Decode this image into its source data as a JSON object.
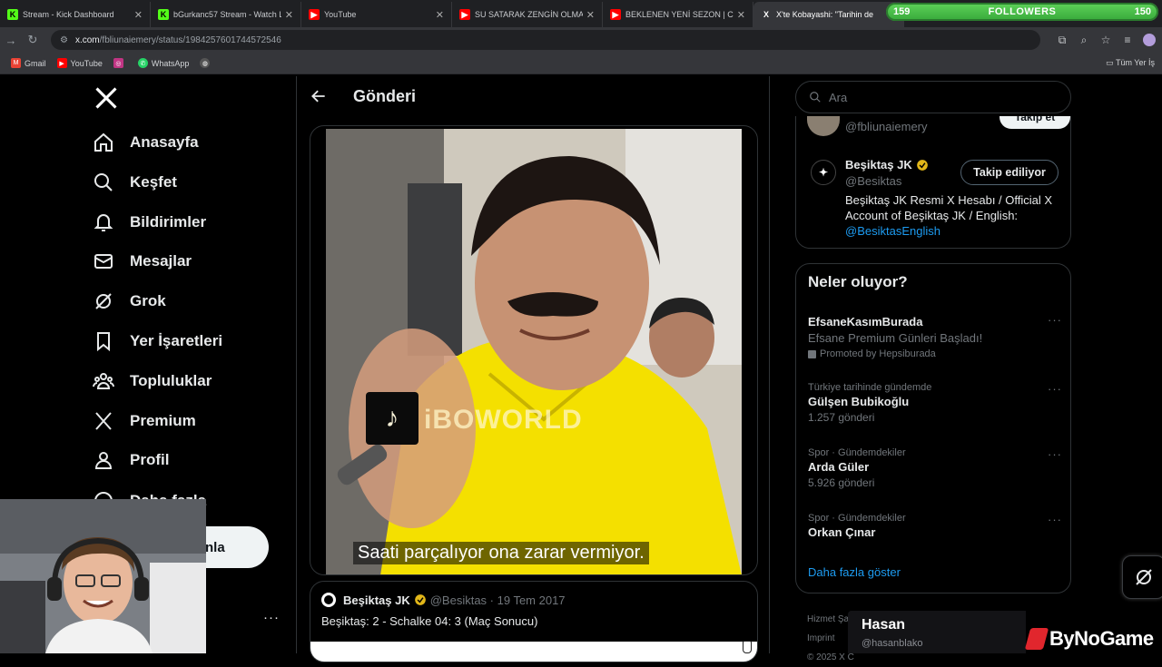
{
  "tabs": [
    {
      "title": "Stream - Kick Dashboard",
      "favicon": "K"
    },
    {
      "title": "bGurkanc57 Stream - Watch Li",
      "favicon": "K"
    },
    {
      "title": "YouTube",
      "favicon": "▶"
    },
    {
      "title": "SU SATARAK ZENGİN OLMAK! (",
      "favicon": "▶"
    },
    {
      "title": "BEKLENEN YENİ SEZON | CİHA",
      "favicon": "▶"
    },
    {
      "title": "X'te Kobayashi: \"Tarihin de",
      "favicon": "X"
    }
  ],
  "followers_overlay": {
    "left_count": "159",
    "label": "FOLLOWERS",
    "right_count": "150"
  },
  "address": {
    "host": "x.com",
    "path": "/fbliunaiemery/status/1984257601744572546"
  },
  "bookmarks": [
    {
      "label": "Gmail",
      "color": "#ea4335"
    },
    {
      "label": "YouTube",
      "color": "#ff0000"
    },
    {
      "label": "",
      "color": "#c13584"
    },
    {
      "label": "WhatsApp",
      "color": "#25d366"
    },
    {
      "label": "",
      "color": "#888888"
    }
  ],
  "bookmarks_right": "Tüm Yer İş",
  "nav": {
    "items": [
      {
        "label": "Anasayfa",
        "icon": "home-icon"
      },
      {
        "label": "Keşfet",
        "icon": "search-icon"
      },
      {
        "label": "Bildirimler",
        "icon": "bell-icon"
      },
      {
        "label": "Mesajlar",
        "icon": "mail-icon"
      },
      {
        "label": "Grok",
        "icon": "grok-icon"
      },
      {
        "label": "Yer İşaretleri",
        "icon": "bookmark-icon"
      },
      {
        "label": "Topluluklar",
        "icon": "communities-icon"
      },
      {
        "label": "Premium",
        "icon": "x-icon"
      },
      {
        "label": "Profil",
        "icon": "profile-icon"
      },
      {
        "label": "Daha fazla",
        "icon": "more-icon"
      }
    ],
    "post_button": "nla",
    "more_dots": "···"
  },
  "post_view": {
    "title": "Gönderi",
    "video_subtitle": "Saati parçalıyor ona zarar vermiyor.",
    "watermark": "iBOWORLD"
  },
  "quote": {
    "name": "Beşiktaş JK",
    "handle": "@Besiktas",
    "date": "19 Tem 2017",
    "text": "Beşiktaş: 2 - Schalke 04: 3 (Maç Sonucu)"
  },
  "search": {
    "placeholder": "Ara"
  },
  "who_to_follow": {
    "partial_handle": "@fbliunaiemery",
    "partial_button": "Takip et",
    "account": {
      "name": "Beşiktaş JK",
      "handle": "@Besiktas",
      "button": "Takip ediliyor",
      "bio": "Beşiktaş JK Resmi X Hesabı / Official X Account of Beşiktaş JK / English: ",
      "bio_link": "@BesiktasEnglish"
    }
  },
  "trends": {
    "title": "Neler oluyor?",
    "items": [
      {
        "context": "",
        "name": "EfsaneKasımBurada",
        "sub": "Efsane Premium Günleri Başladı!",
        "promo": "Promoted by Hepsiburada"
      },
      {
        "context": "Türkiye tarihinde gündemde",
        "name": "Gülşen Bubikoğlu",
        "sub": "1.257 gönderi",
        "promo": ""
      },
      {
        "context": "Spor · Gündemdekiler",
        "name": "Arda Güler",
        "sub": "5.926 gönderi",
        "promo": ""
      },
      {
        "context": "Spor · Gündemdekiler",
        "name": "Orkan Çınar",
        "sub": "",
        "promo": ""
      }
    ],
    "show_more": "Daha fazla göster"
  },
  "footer": {
    "line1": "Hizmet Şart",
    "line2": "Imprint",
    "line3": "© 2025 X C"
  },
  "chatter": {
    "name": "Hasan",
    "handle": "@hasanblako"
  },
  "sponsor": "ByNoGame",
  "colors": {
    "accent": "#1d9bf0",
    "followers_bar": "#4cc24a",
    "kick": "#53fc18"
  }
}
